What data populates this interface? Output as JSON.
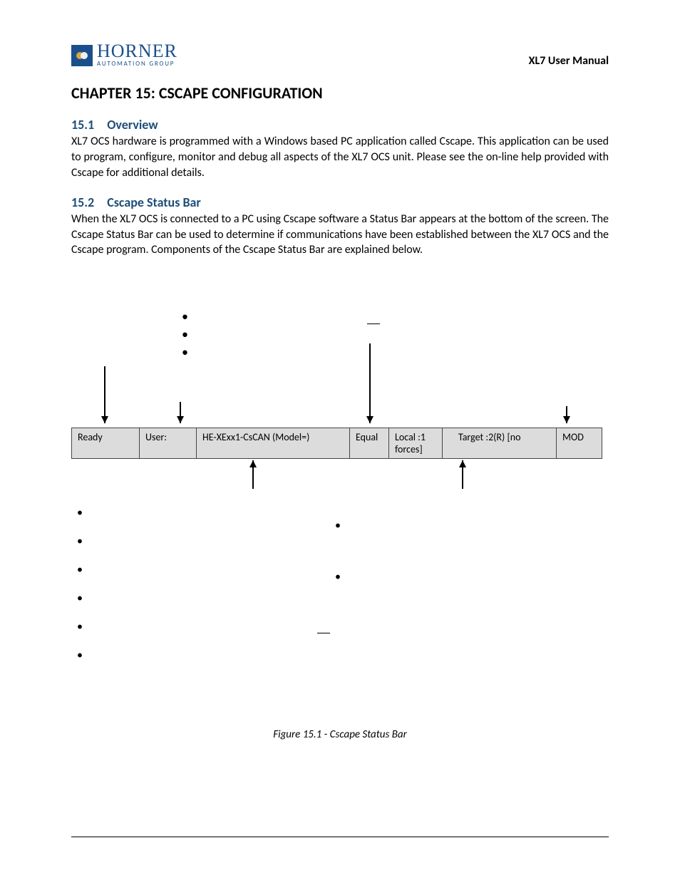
{
  "header": {
    "logo_name": "HORNER",
    "logo_sub": "AUTOMATION GROUP",
    "manual_title": "XL7 User Manual"
  },
  "chapter_title": "CHAPTER 15:  CSCAPE CONFIGURATION",
  "section1": {
    "num": "15.1",
    "title": "Overview",
    "body": "XL7 OCS hardware is programmed with a Windows based PC application called Cscape.  This application can be used to program, configure, monitor and debug all aspects of the XL7 OCS unit.  Please see the on-line help provided with Cscape for additional details."
  },
  "section2": {
    "num": "15.2",
    "title": "Cscape Status Bar",
    "body": "When the XL7 OCS is connected to a PC using Cscape software a Status Bar appears at the bottom of the screen.  The Cscape Status Bar can be used to determine if communications have been established between the XL7 OCS and the Cscape program.  Components of the Cscape Status Bar are explained below."
  },
  "status_bar": {
    "ready": "Ready",
    "user": "User:",
    "model": "HE-XExx1-CsCAN (Model=)",
    "equal": "Equal",
    "local_line1": "Local :1",
    "local_line2": "forces]",
    "target": "Target :2(R)  [no",
    "mod": "MOD"
  },
  "figure_caption": "Figure 15.1 - Cscape Status Bar"
}
